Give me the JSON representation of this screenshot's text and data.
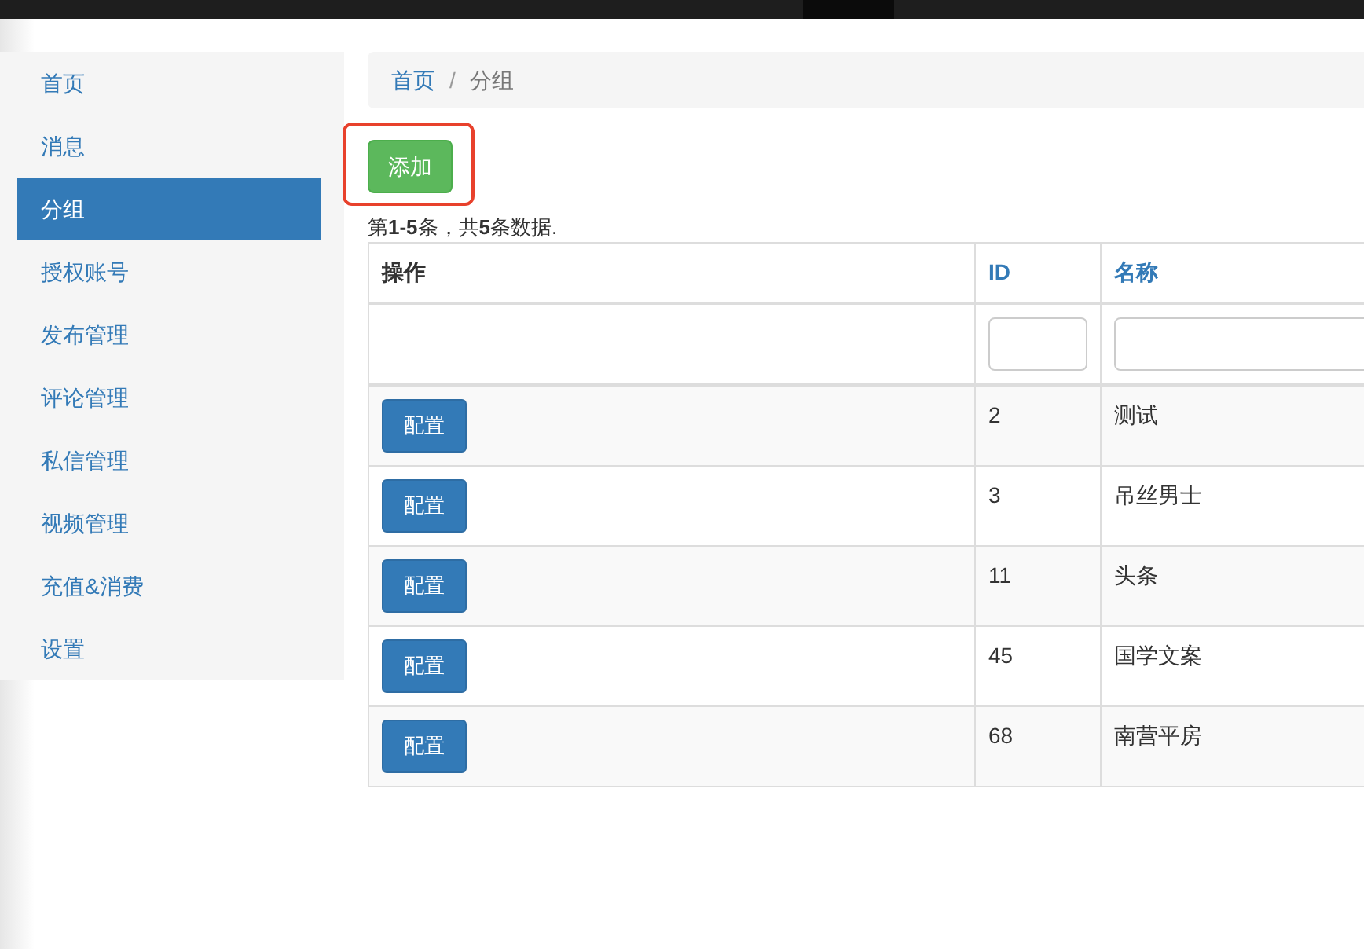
{
  "sidebar": {
    "items": [
      {
        "label": "首页",
        "selected": false
      },
      {
        "label": "消息",
        "selected": false
      },
      {
        "label": "分组",
        "selected": true
      },
      {
        "label": "授权账号",
        "selected": false
      },
      {
        "label": "发布管理",
        "selected": false
      },
      {
        "label": "评论管理",
        "selected": false
      },
      {
        "label": "私信管理",
        "selected": false
      },
      {
        "label": "视频管理",
        "selected": false
      },
      {
        "label": "充值&消费",
        "selected": false
      },
      {
        "label": "设置",
        "selected": false
      }
    ]
  },
  "breadcrumb": [
    {
      "label": "首页",
      "kind": "link"
    },
    {
      "label": "/",
      "kind": "separator"
    },
    {
      "label": "分组",
      "kind": "current"
    }
  ],
  "add_button": {
    "label": "添加",
    "highlighted": true
  },
  "summary": "第**1-5**条，共**5**条数据.",
  "table": {
    "columns": [
      {
        "label": "操作",
        "sortable": false
      },
      {
        "label": "ID",
        "sortable": true
      },
      {
        "label": "名称",
        "sortable": true
      }
    ],
    "filters": [
      false,
      true,
      true
    ],
    "rows": [
      {
        "action": "配置",
        "id": "2",
        "name": "测试"
      },
      {
        "action": "配置",
        "id": "3",
        "name": "吊丝男士"
      },
      {
        "action": "配置",
        "id": "11",
        "name": "头条"
      },
      {
        "action": "配置",
        "id": "45",
        "name": "国学文案"
      },
      {
        "action": "配置",
        "id": "68",
        "name": "南营平房"
      }
    ]
  }
}
